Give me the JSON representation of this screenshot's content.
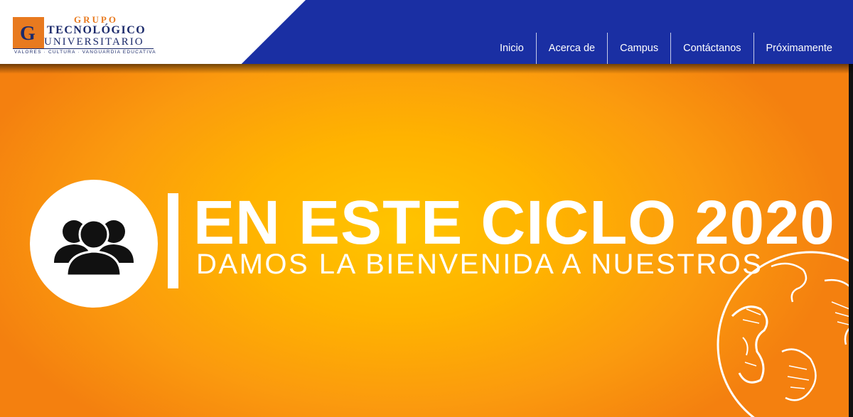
{
  "header": {
    "logo": {
      "mark": "GTU",
      "line1": "GRUPO",
      "line2": "TECNOLÓGICO",
      "line3": "UNIVERSITARIO",
      "tagline": "VALORES · CULTURA · VANGUARDIA EDUCATIVA"
    },
    "nav": [
      {
        "label": "Inicio"
      },
      {
        "label": "Acerca de"
      },
      {
        "label": "Campus"
      },
      {
        "label": "Contáctanos"
      },
      {
        "label": "Próximamente"
      }
    ]
  },
  "hero": {
    "title": "EN ESTE CICLO 2020",
    "subtitle": "DAMOS LA BIENVENIDA A NUESTROS",
    "icon": "users-icon",
    "decoration": "globe-icon"
  },
  "colors": {
    "header_blue": "#1a2fa3",
    "brand_orange": "#e87a1f",
    "brand_navy": "#1b2a6b",
    "hero_yellow": "#ffc400",
    "hero_orange": "#f4800f"
  }
}
